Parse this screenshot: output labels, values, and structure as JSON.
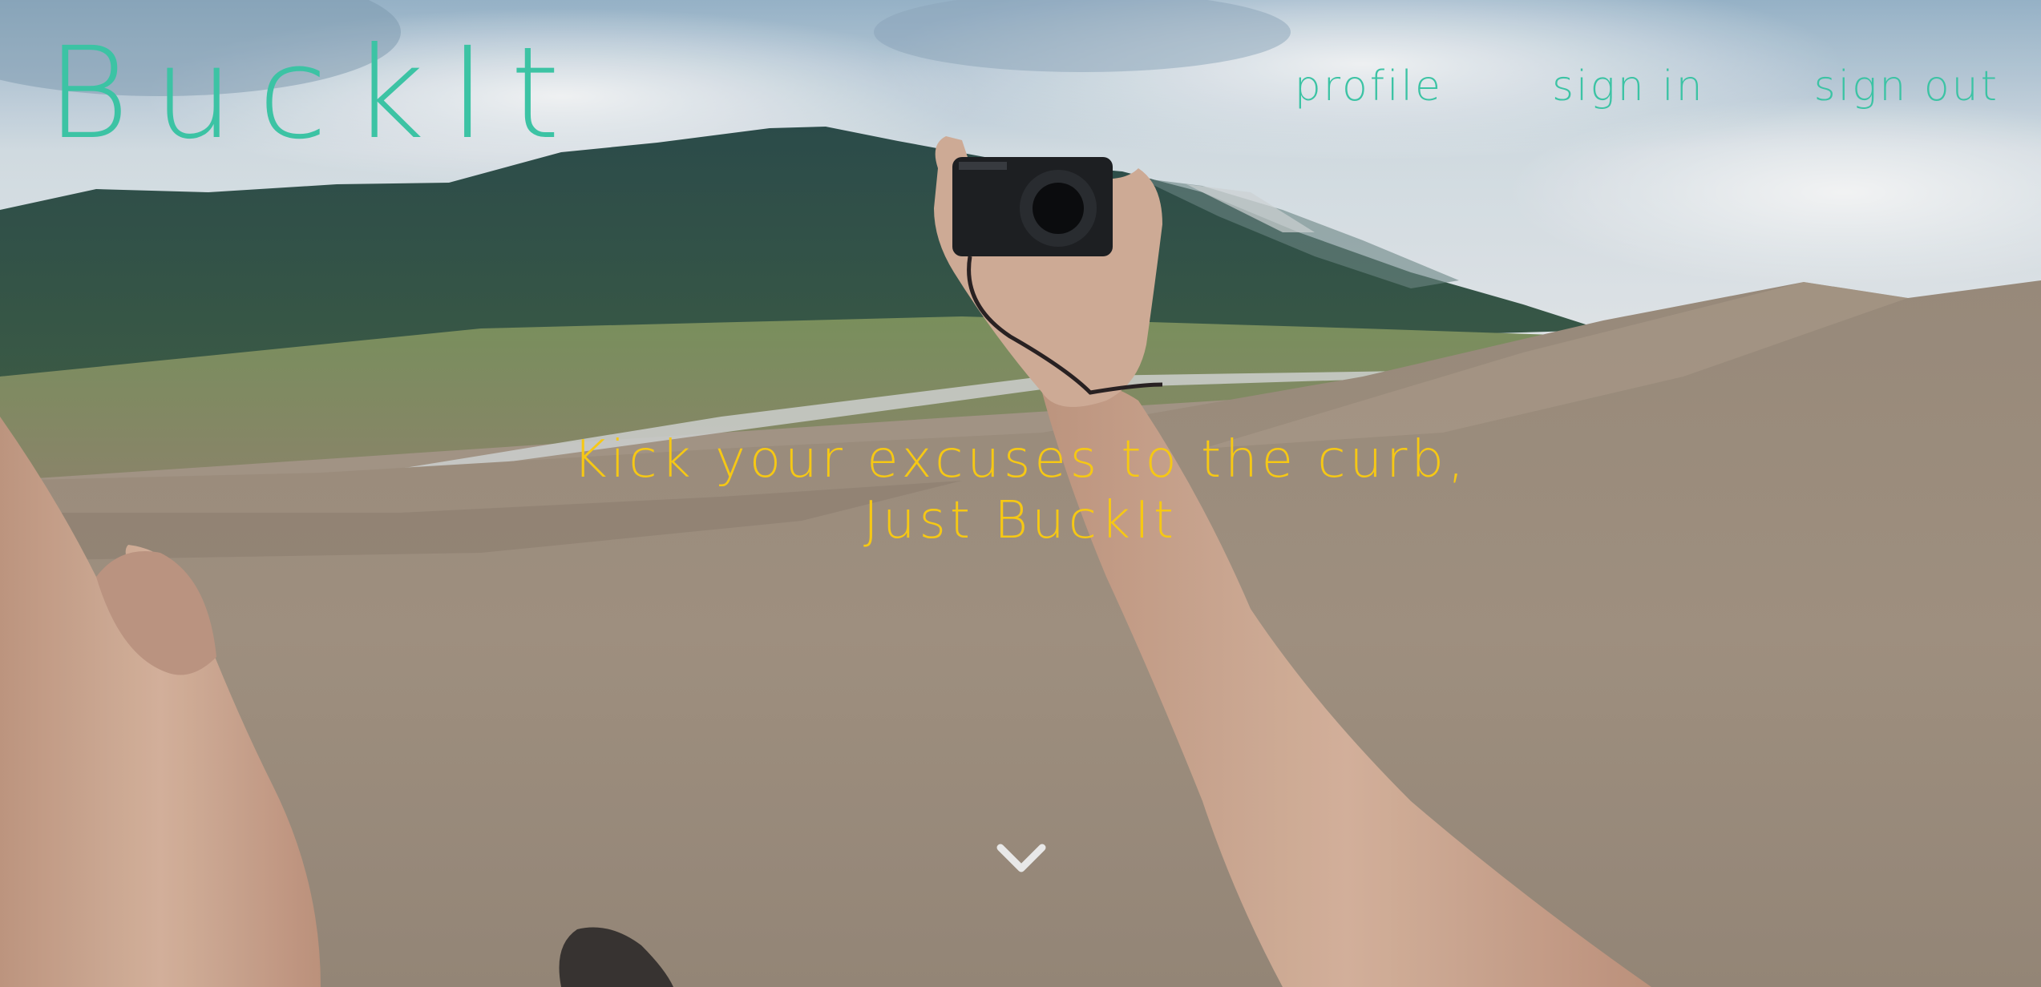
{
  "header": {
    "logo": "BuckIt",
    "nav": {
      "profile": "profile",
      "sign_in": "sign in",
      "sign_out": "sign out"
    }
  },
  "hero": {
    "tagline_line1": "Kick your excuses to the curb,",
    "tagline_line2": "Just BuckIt",
    "scroll_icon": "chevron-down-icon",
    "background_image": "pov-sand-dune-camera-photo"
  },
  "colors": {
    "accent": "#3cc3a4",
    "tagline": "#f6c814",
    "chevron": "#e8e8e8"
  }
}
